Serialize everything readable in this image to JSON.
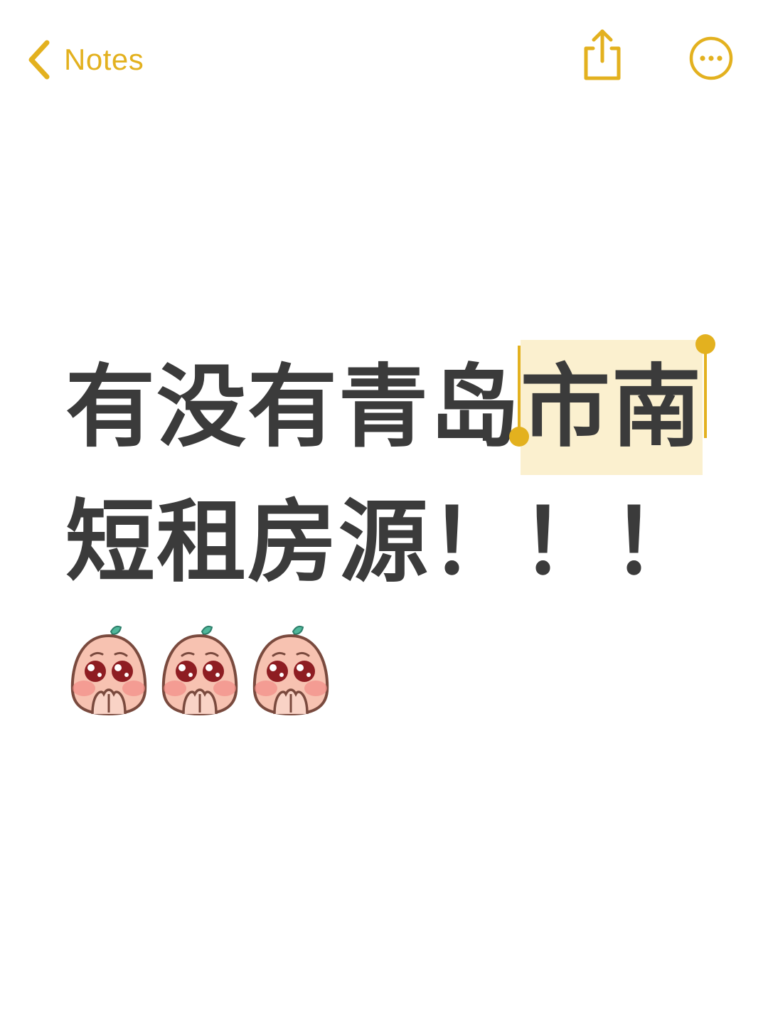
{
  "nav": {
    "back_label": "Notes"
  },
  "note": {
    "line1_before": "有没有青岛",
    "line1_selected": "市南",
    "line2": "短租房源！！！",
    "emoji_names": [
      "pleading-peach-emoji",
      "pleading-peach-emoji",
      "pleading-peach-emoji"
    ]
  },
  "colors": {
    "accent": "#E3B11F",
    "selection": "#FBF0CF",
    "text": "#3b3b3b"
  },
  "icons": {
    "back": "chevron-left-icon",
    "share": "share-icon",
    "more": "more-options-icon"
  }
}
